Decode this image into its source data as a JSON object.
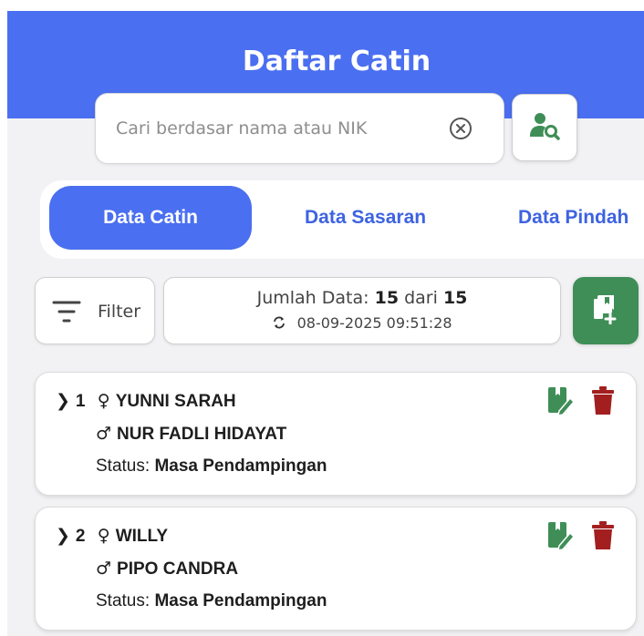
{
  "header": {
    "title": "Daftar Catin"
  },
  "search": {
    "placeholder": "Cari berdasar nama atau NIK",
    "value": ""
  },
  "icons": {
    "clear": "clear-circle-icon",
    "user_search": "user-search-icon",
    "filter": "filter-icon",
    "sync": "sync-icon",
    "add": "add-document-icon",
    "edit": "edit-document-icon",
    "delete": "trash-icon",
    "expand": "chevron-right-icon",
    "female": "female-symbol",
    "male": "male-symbol"
  },
  "tabs": [
    {
      "label": "Data Catin",
      "active": true
    },
    {
      "label": "Data Sasaran",
      "active": false
    },
    {
      "label": "Data Pindah",
      "active": false
    }
  ],
  "toolbar": {
    "filter_label": "Filter",
    "count_label": "Jumlah Data:",
    "count_shown": "15",
    "count_of": "dari",
    "count_total": "15",
    "sync_time": "08-09-2025 09:51:28"
  },
  "records": [
    {
      "index": "1",
      "female_name": "YUNNI SARAH",
      "male_name": "NUR FADLI HIDAYAT",
      "status_label": "Status:",
      "status": "Masa Pendampingan"
    },
    {
      "index": "2",
      "female_name": "WILLY",
      "male_name": "PIPO CANDRA",
      "status_label": "Status:",
      "status": "Masa Pendampingan"
    }
  ],
  "colors": {
    "primary": "#4a6ff0",
    "tab_text": "#3e63e0",
    "add_button": "#3f8e57",
    "edit_icon": "#3f8e57",
    "delete_icon": "#a31f1f",
    "background": "#f2f2f4"
  }
}
